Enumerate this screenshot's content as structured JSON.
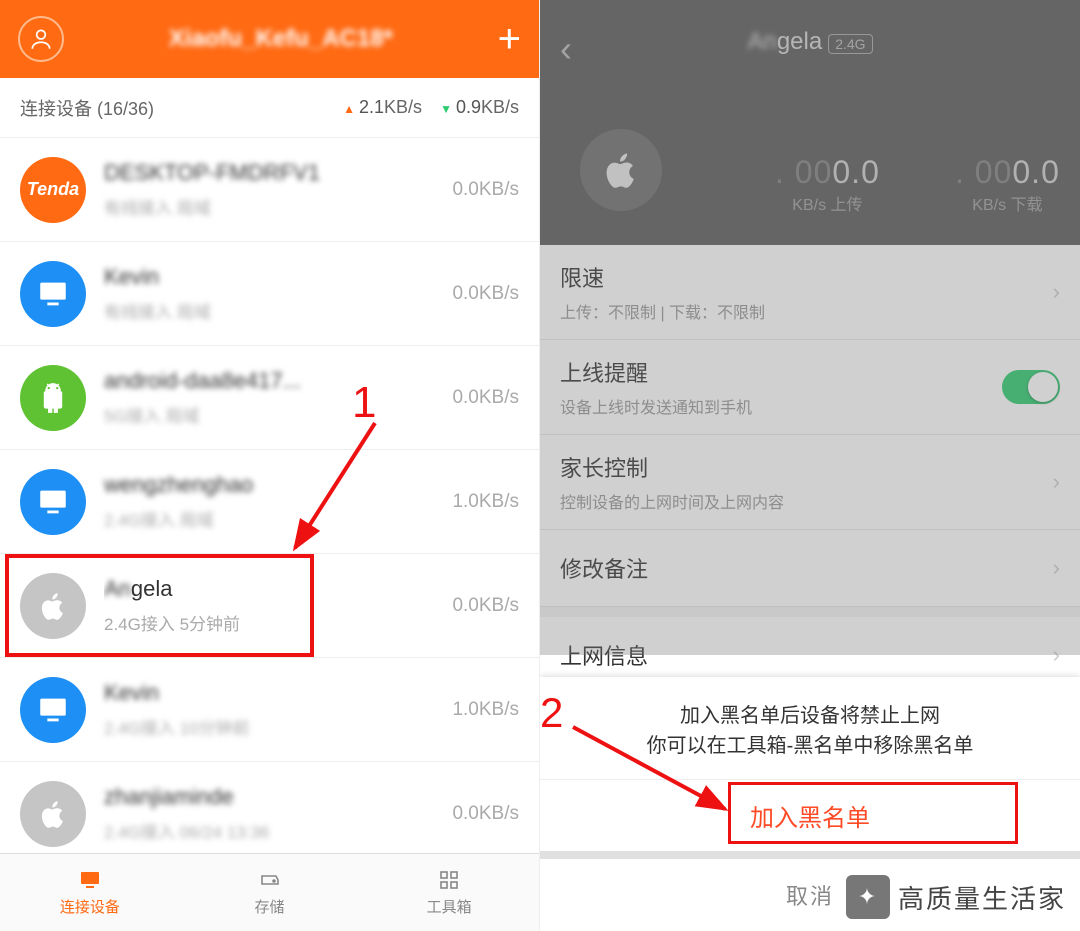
{
  "left": {
    "header_title": "Xiaofu_Kefu_AC18*",
    "sub": {
      "label": "连接设备 (16/36)",
      "up": "2.1",
      "down": "0.9",
      "unit": "KB/s"
    },
    "devices": [
      {
        "name": "DESKTOP-FMDRFV1",
        "sub": "有线接入  局域",
        "speed": "0.0KB/s",
        "icon": "tenda"
      },
      {
        "name": "Kevin",
        "sub": "有线接入  局域",
        "speed": "0.0KB/s",
        "icon": "pc"
      },
      {
        "name": "android-daa8e417...",
        "sub": "5G接入  局域",
        "speed": "0.0KB/s",
        "icon": "android"
      },
      {
        "name": "wengzhenghao",
        "sub": "2.4G接入  局域",
        "speed": "1.0KB/s",
        "icon": "pc"
      },
      {
        "name": "Angela",
        "sub": "2.4G接入   5分钟前",
        "speed": "0.0KB/s",
        "icon": "apple",
        "highlight": true,
        "clear": true
      },
      {
        "name": "Kevin",
        "sub": "2.4G接入  10分钟前",
        "speed": "1.0KB/s",
        "icon": "pc"
      },
      {
        "name": "zhanjiaminde",
        "sub": "2.4G接入  06/24 13:36",
        "speed": "0.0KB/s",
        "icon": "apple"
      }
    ],
    "tabs": {
      "devices": "连接设备",
      "storage": "存储",
      "tools": "工具箱"
    },
    "anno": "1"
  },
  "right": {
    "title_blur": "An",
    "title_clear": "gela",
    "badge": "2.4G",
    "stat_value": "000.0",
    "up": {
      "label": "KB/s 上传"
    },
    "dn": {
      "label": "KB/s 下载"
    },
    "opts": {
      "limit_t": "限速",
      "limit_s": "上传：不限制 | 下载：不限制",
      "online_t": "上线提醒",
      "online_s": "设备上线时发送通知到手机",
      "parent_t": "家长控制",
      "parent_s": "控制设备的上网时间及上网内容",
      "rename_t": "修改备注",
      "info_t": "上网信息"
    },
    "sheet": {
      "msg1": "加入黑名单后设备将禁止上网",
      "msg2": "你可以在工具箱-黑名单中移除黑名单",
      "action": "加入黑名单",
      "cancel": "取消"
    },
    "anno": "2"
  },
  "watermark": "高质量生活家"
}
